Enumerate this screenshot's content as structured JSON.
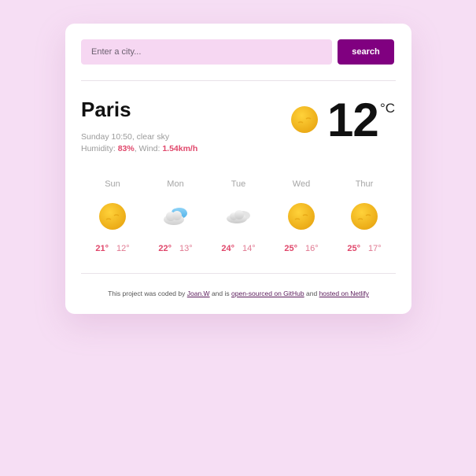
{
  "search": {
    "placeholder": "Enter a city...",
    "button_label": "search"
  },
  "current": {
    "city": "Paris",
    "date_time": "Sunday 10:50",
    "description": "clear sky",
    "humidity_label": "Humidity:",
    "humidity": "83%",
    "wind_label": "Wind:",
    "wind": "1.54km/h",
    "temperature": "12",
    "unit": "°C",
    "icon": "sun-icon"
  },
  "forecast": [
    {
      "day": "Sun",
      "max": "21°",
      "min": "12°",
      "icon": "sun-icon"
    },
    {
      "day": "Mon",
      "max": "22°",
      "min": "13°",
      "icon": "cloud-rain-icon"
    },
    {
      "day": "Tue",
      "max": "24°",
      "min": "14°",
      "icon": "cloud-icon"
    },
    {
      "day": "Wed",
      "max": "25°",
      "min": "16°",
      "icon": "sun-icon"
    },
    {
      "day": "Thur",
      "max": "25°",
      "min": "17°",
      "icon": "sun-icon"
    }
  ],
  "footer": {
    "text1": "This project was coded by",
    "author_link": "Joan.W",
    "text2": "and is",
    "github_link": "open-sourced on GitHub",
    "text3": "and",
    "netlify_link": "hosted on Netlify"
  },
  "colors": {
    "background": "#f6def4",
    "accent": "#800080",
    "highlight": "#e0476b",
    "input_bg": "#f6d7f2"
  }
}
